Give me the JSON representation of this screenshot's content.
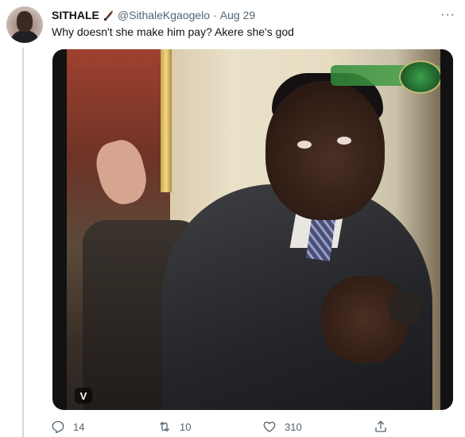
{
  "tweet": {
    "display_name": "SITHALE",
    "name_emoji": "bottle-emoji",
    "handle": "@SithaleKgaogelo",
    "separator": "·",
    "date": "Aug 29",
    "more": "···",
    "text": "Why doesn't she make him pay?  Akere she's god",
    "media": {
      "badge": "V",
      "overlay_logo": "channel-logo"
    },
    "actions": {
      "reply_count": "14",
      "retweet_count": "10",
      "like_count": "310",
      "share_count": ""
    }
  },
  "colors": {
    "secondary_text": "#536471",
    "primary_text": "#0f1419",
    "thread_line": "#cfd9de"
  }
}
